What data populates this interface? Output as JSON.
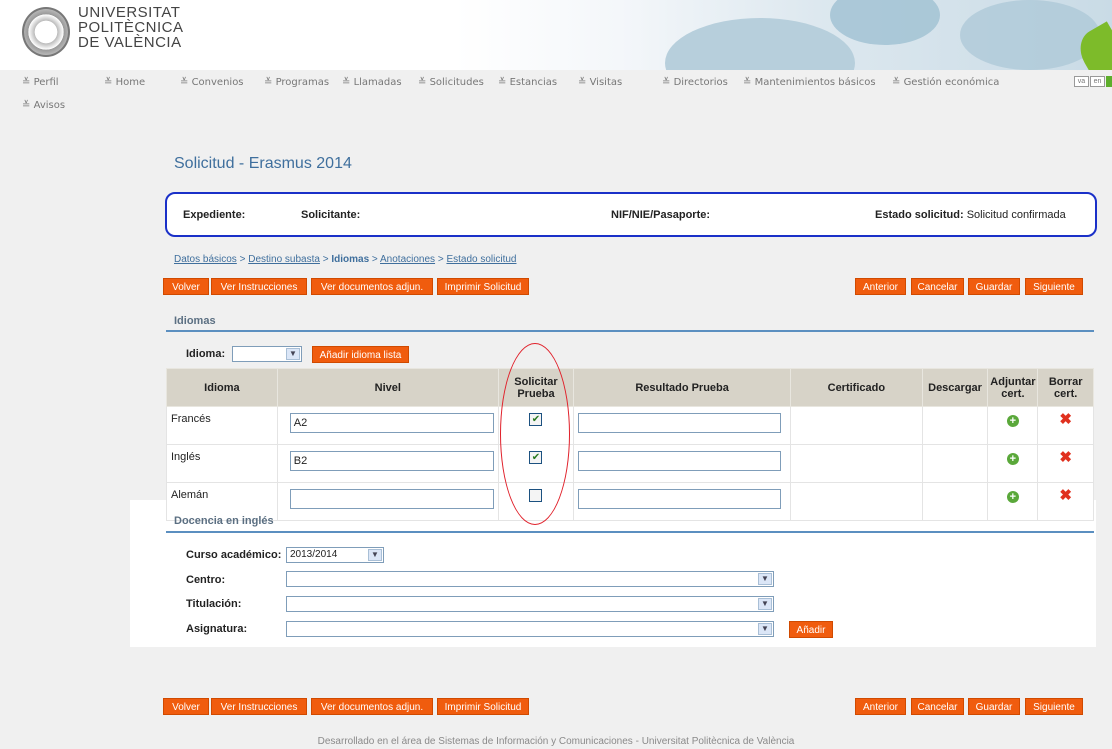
{
  "header": {
    "logo_lines": [
      "UNIVERSITAT",
      "POLITÈCNICA",
      "DE VALÈNCIA"
    ]
  },
  "nav": {
    "items": [
      "Perfil",
      "Home",
      "Convenios",
      "Programas",
      "Llamadas",
      "Solicitudes",
      "Estancias",
      "Visitas",
      "Directorios",
      "Mantenimientos básicos",
      "Gestión económica",
      "Avisos"
    ],
    "languages": [
      "va",
      "en"
    ]
  },
  "page": {
    "title": "Solicitud - Erasmus 2014"
  },
  "info": {
    "expediente_label": "Expediente:",
    "solicitante_label": "Solicitante:",
    "nif_label": "NIF/NIE/Pasaporte:",
    "nif_value": "",
    "estado_label": "Estado solicitud:",
    "estado_value": "Solicitud confirmada"
  },
  "breadcrumb": {
    "items": [
      "Datos básicos",
      "Destino subasta",
      "Idiomas",
      "Anotaciones",
      "Estado solicitud"
    ],
    "separator": ">",
    "current": "Idiomas"
  },
  "actions": {
    "volver": "Volver",
    "ver_instrucciones": "Ver Instrucciones",
    "ver_documentos": "Ver documentos adjun.",
    "imprimir": "Imprimir Solicitud",
    "anterior": "Anterior",
    "cancelar": "Cancelar",
    "guardar": "Guardar",
    "siguiente": "Siguiente"
  },
  "idiomas": {
    "section_title": "Idiomas",
    "idioma_label": "Idioma:",
    "idioma_selected": "",
    "add_button": "Añadir idioma lista",
    "columns": [
      "Idioma",
      "Nivel",
      "Solicitar Prueba",
      "Resultado Prueba",
      "Certificado",
      "Descargar",
      "Adjuntar cert.",
      "Borrar cert."
    ],
    "rows": [
      {
        "idioma": "Francés",
        "nivel": "A2",
        "solicitar": true,
        "resultado": ""
      },
      {
        "idioma": "Inglés",
        "nivel": "B2",
        "solicitar": true,
        "resultado": ""
      },
      {
        "idioma": "Alemán",
        "nivel": "",
        "solicitar": false,
        "resultado": ""
      }
    ]
  },
  "docencia": {
    "section_title": "Docencia en inglés",
    "curso_label": "Curso académico:",
    "curso_value": "2013/2014",
    "centro_label": "Centro:",
    "centro_value": "",
    "titulacion_label": "Titulación:",
    "titulacion_value": "",
    "asignatura_label": "Asignatura:",
    "asignatura_value": "",
    "add_button": "Añadir"
  },
  "footer": {
    "text": "Desarrollado en el área de Sistemas de Información y Comunicaciones - Universitat Politècnica de València"
  },
  "colors": {
    "accent_orange": "#f05c0e",
    "title_blue": "#3f6f9d",
    "info_border": "#1a30c8",
    "annotation_red": "#e0202a"
  }
}
